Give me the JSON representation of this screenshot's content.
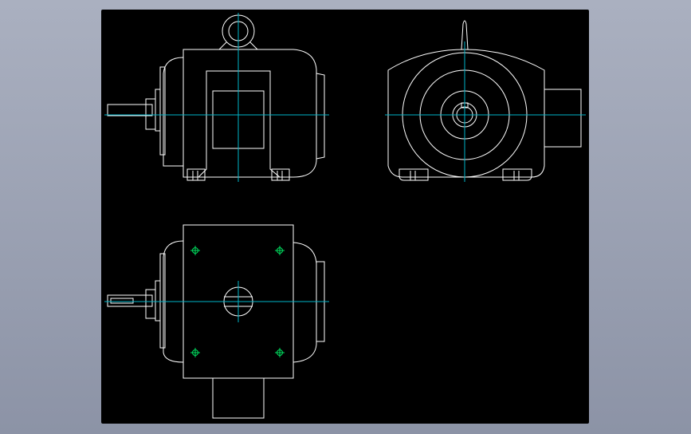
{
  "canvas": {
    "background": "#000000",
    "page_background": "#9aa1b4"
  },
  "colors": {
    "outline": "#ffffff",
    "centerline": "#00b4c8",
    "hole": "#00e060"
  },
  "views": [
    {
      "name": "front-view"
    },
    {
      "name": "side-view"
    },
    {
      "name": "top-view"
    }
  ]
}
